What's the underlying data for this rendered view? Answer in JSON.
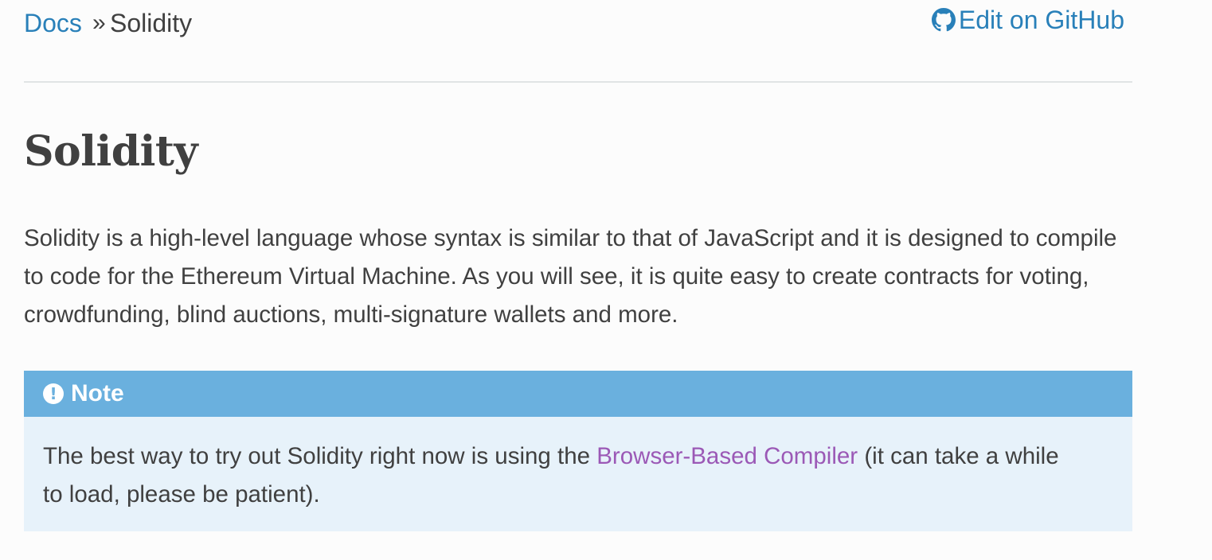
{
  "breadcrumbs": {
    "docs_label": "Docs",
    "separator": "»",
    "current": "Solidity"
  },
  "edit_link": {
    "icon": "github-icon",
    "label": "Edit on GitHub"
  },
  "page": {
    "title": "Solidity",
    "intro": "Solidity is a high-level language whose syntax is similar to that of JavaScript and it is designed to compile to code for the Ethereum Virtual Machine. As you will see, it is quite easy to create contracts for voting, crowdfunding, blind auctions, multi-signature wallets and more."
  },
  "note": {
    "icon": "exclamation-circle-icon",
    "title": "Note",
    "text_before": "The best way to try out Solidity right now is using the ",
    "link_label": "Browser-Based Compiler",
    "text_after": " (it can take a while to load, please be patient)."
  },
  "colors": {
    "link": "#2980b9",
    "visited_link": "#9b59b6",
    "note_header": "#6ab0de",
    "note_body": "#e7f2fa",
    "text": "#404040"
  }
}
